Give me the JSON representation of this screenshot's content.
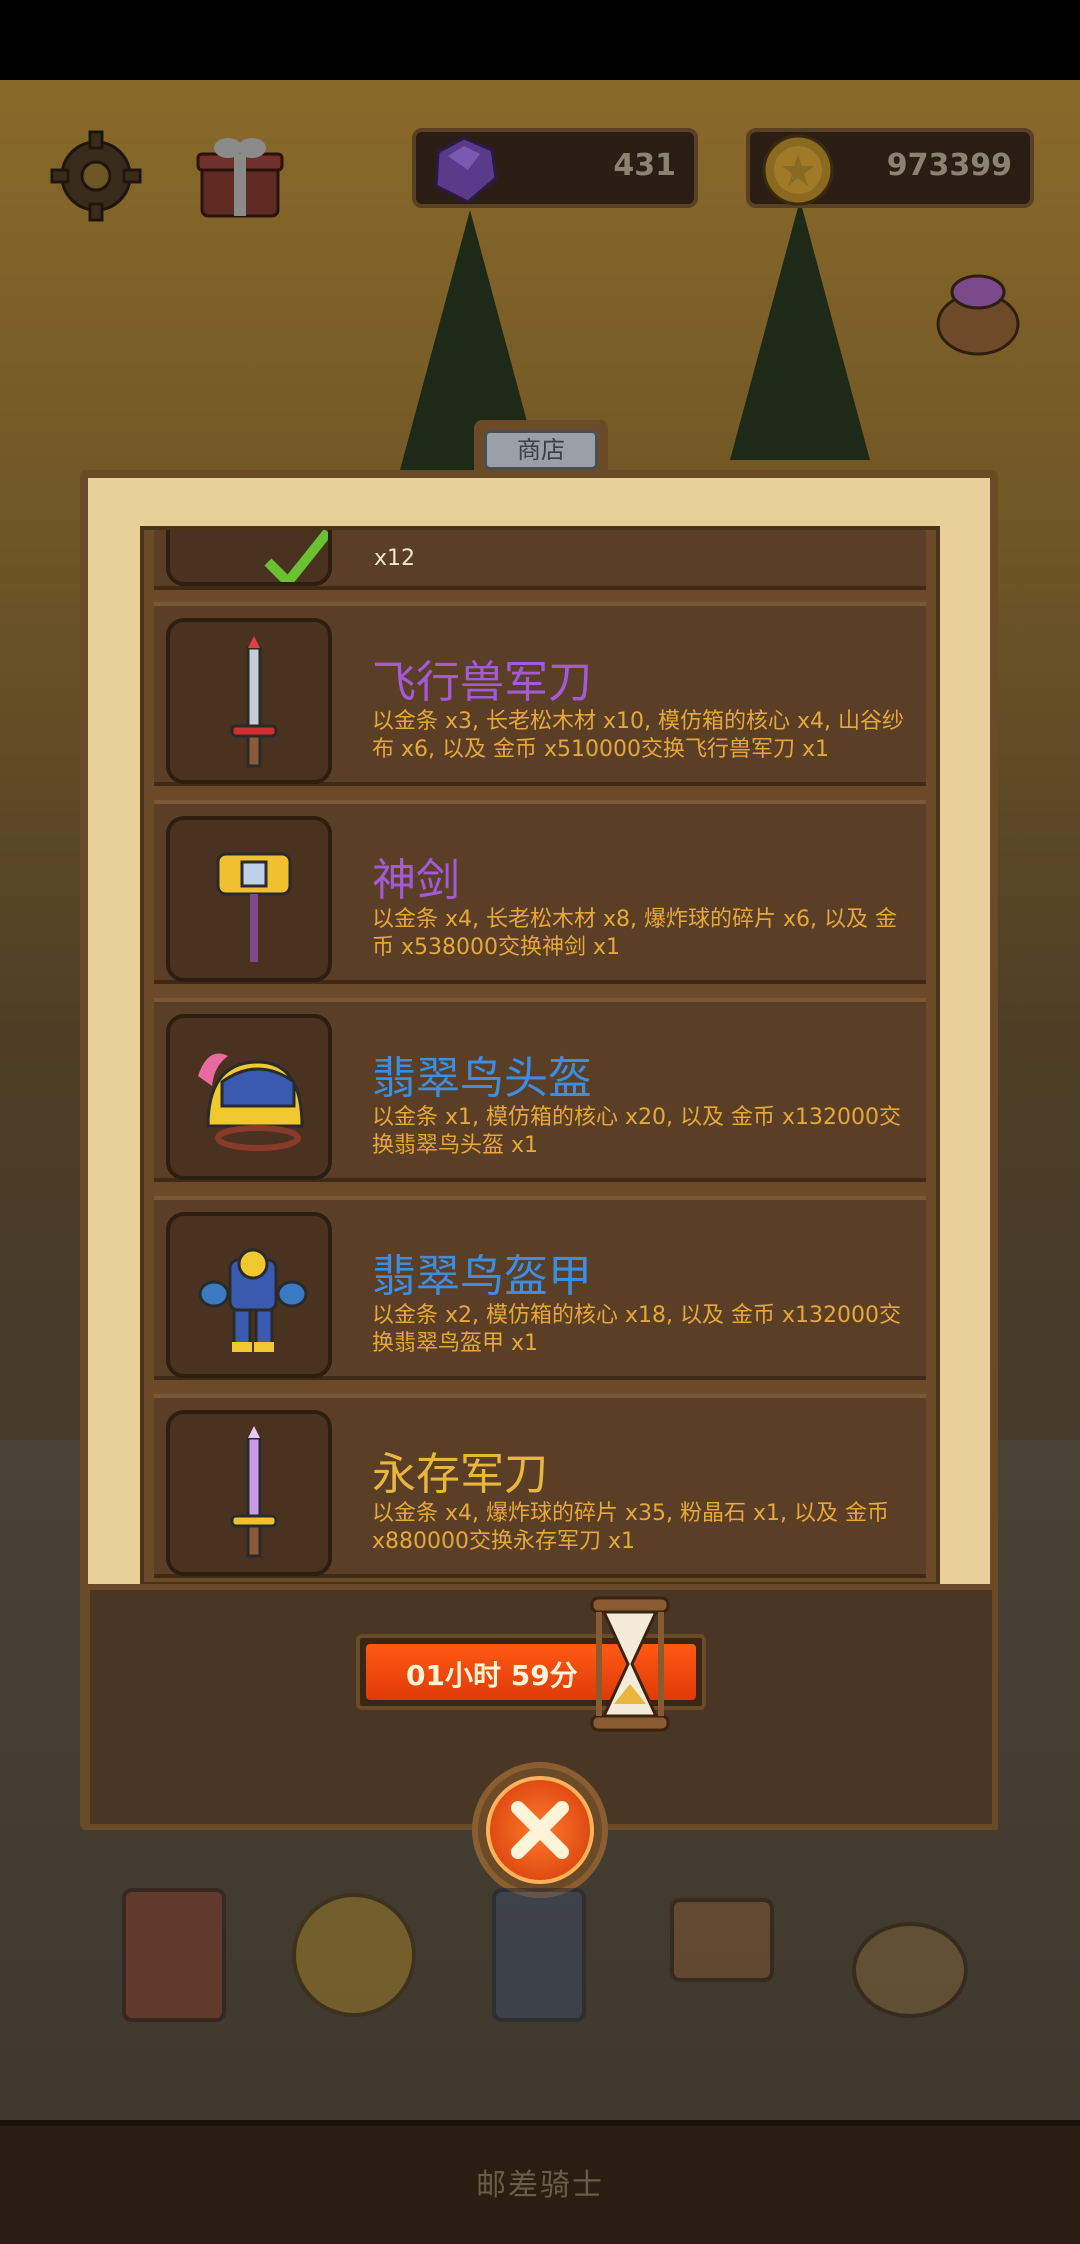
{
  "hud": {
    "gems": "431",
    "coins": "973399"
  },
  "shop": {
    "tab_label": "商店",
    "partial_item_qty": "x12",
    "items": [
      {
        "name": "飞行兽军刀",
        "name_color": "purple",
        "desc": "以金条 x3, 长老松木材 x10, 模仿箱的核心 x4, 山谷纱布 x6, 以及 金币 x510000交换飞行兽军刀 x1",
        "icon": "sword-red-icon"
      },
      {
        "name": "神剑",
        "name_color": "purple",
        "desc": "以金条 x4, 长老松木材 x8, 爆炸球的碎片 x6, 以及 金币 x538000交换神剑 x1",
        "icon": "hammer-gold-icon"
      },
      {
        "name": "翡翠鸟头盔",
        "name_color": "blue",
        "desc": "以金条 x1, 模仿箱的核心 x20, 以及 金币 x132000交换翡翠鸟头盔 x1",
        "icon": "helmet-icon"
      },
      {
        "name": "翡翠鸟盔甲",
        "name_color": "blue",
        "desc": "以金条 x2, 模仿箱的核心 x18, 以及 金币 x132000交换翡翠鸟盔甲 x1",
        "icon": "armor-icon"
      },
      {
        "name": "永存军刀",
        "name_color": "gold",
        "desc": "以金条 x4, 爆炸球的碎片 x35, 粉晶石 x1, 以及 金币 x880000交换永存军刀 x1",
        "icon": "sword-purple-icon"
      }
    ]
  },
  "timer": {
    "text": "01小时 59分"
  },
  "footer": {
    "title": "邮差骑士"
  }
}
